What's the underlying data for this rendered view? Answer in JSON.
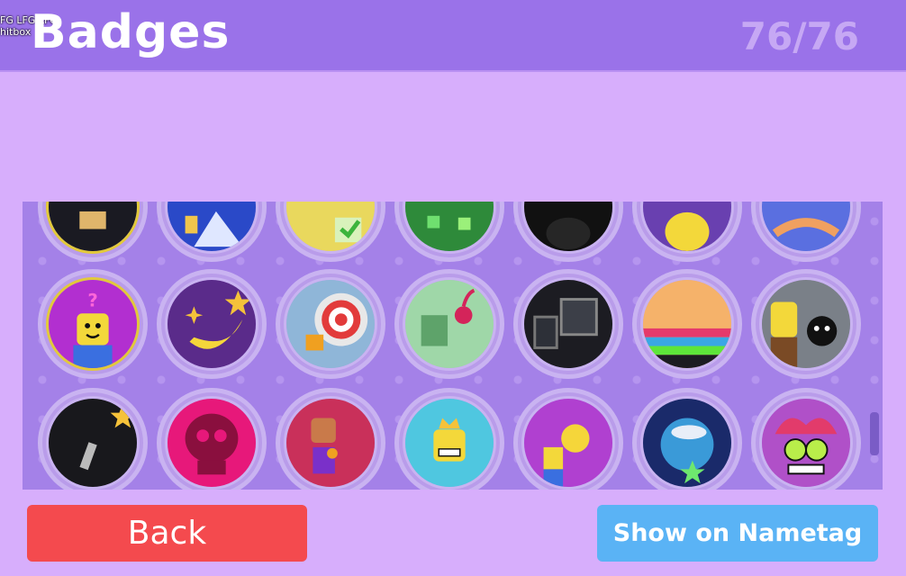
{
  "header": {
    "title": "Badges",
    "count": "76/76",
    "overlay_line1": "FG LFG LFG",
    "overlay_line2": "hitbox"
  },
  "buttons": {
    "back_label": "Back",
    "nametag_label": "Show on Nametag"
  },
  "colors": {
    "header": "#9a72e9",
    "background": "#d7aefc",
    "grid": "#a481e8",
    "back": "#f44a4e",
    "nametag": "#5ab3f5"
  },
  "badges": [
    {
      "icon": "noob-tumble-badge-icon"
    },
    {
      "icon": "mountain-climber-badge-icon"
    },
    {
      "icon": "paper-check-badge-icon"
    },
    {
      "icon": "green-cubes-badge-icon"
    },
    {
      "icon": "shadow-figure-badge-icon"
    },
    {
      "icon": "yellow-noob-badge-icon"
    },
    {
      "icon": "blue-wave-badge-icon"
    },
    {
      "icon": "question-noob-badge-icon"
    },
    {
      "icon": "banana-star-badge-icon"
    },
    {
      "icon": "target-hit-badge-icon"
    },
    {
      "icon": "cherry-block-badge-icon"
    },
    {
      "icon": "broken-window-badge-icon"
    },
    {
      "icon": "rainbow-piano-badge-icon"
    },
    {
      "icon": "noob-bomb-badge-icon"
    },
    {
      "icon": "dark-star-badge-icon"
    },
    {
      "icon": "pink-skull-badge-icon"
    },
    {
      "icon": "red-noob-badge-icon"
    },
    {
      "icon": "grinning-king-badge-icon"
    },
    {
      "icon": "rainbow-bomb-badge-icon"
    },
    {
      "icon": "earth-cloud-badge-icon"
    },
    {
      "icon": "jester-hypno-badge-icon"
    }
  ]
}
